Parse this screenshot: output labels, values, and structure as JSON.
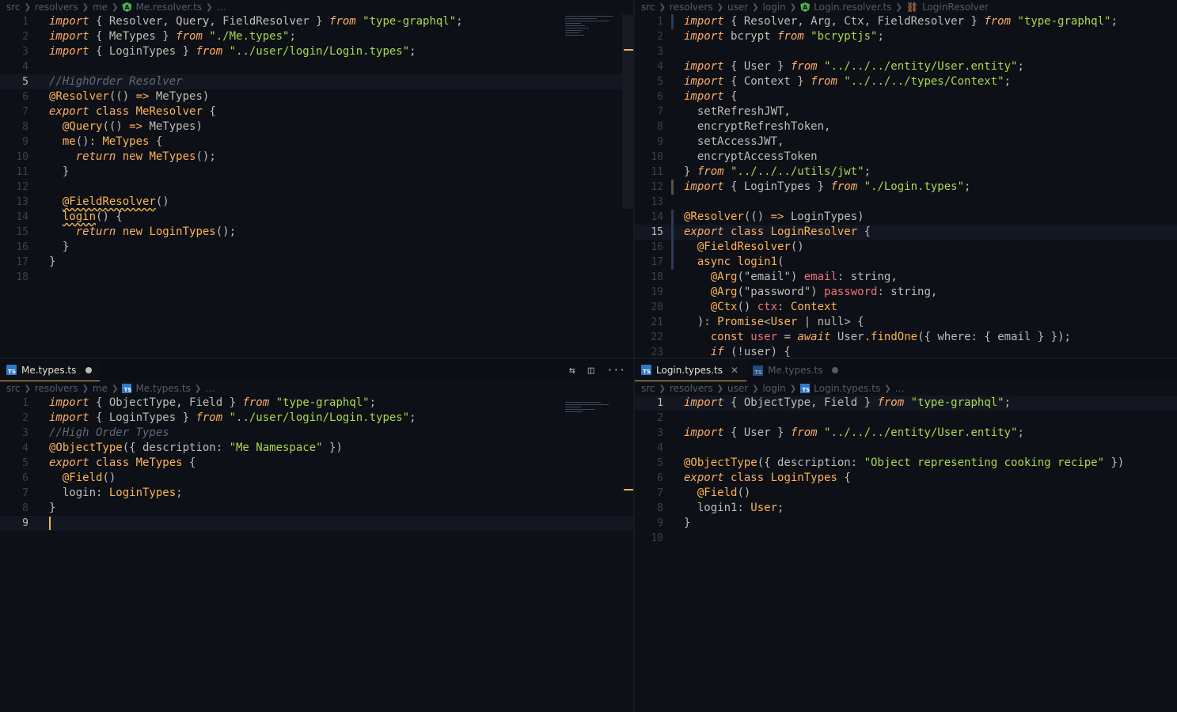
{
  "panes": {
    "top_left": {
      "breadcrumb": [
        "src",
        "resolvers",
        "me",
        "Me.resolver.ts",
        "…"
      ],
      "lines": [
        [
          [
            "c-imp",
            "import"
          ],
          [
            "c-plain",
            " { Resolver, Query, FieldResolver } "
          ],
          [
            "c-from",
            "from"
          ],
          [
            "c-str",
            " \"type-graphql\""
          ],
          [
            "c-plain",
            ";"
          ]
        ],
        [
          [
            "c-imp",
            "import"
          ],
          [
            "c-plain",
            " { MeTypes } "
          ],
          [
            "c-from",
            "from"
          ],
          [
            "c-str",
            " \"./Me.types\""
          ],
          [
            "c-plain",
            ";"
          ]
        ],
        [
          [
            "c-imp",
            "import"
          ],
          [
            "c-plain",
            " { LoginTypes } "
          ],
          [
            "c-from",
            "from"
          ],
          [
            "c-str",
            " \"../user/login/Login.types\""
          ],
          [
            "c-plain",
            ";"
          ]
        ],
        [],
        [
          [
            "c-cm",
            "//HighOrder Resolver"
          ]
        ],
        [
          [
            "c-dec",
            "@Resolver"
          ],
          [
            "c-plain",
            "(() "
          ],
          [
            "c-kw",
            "=>"
          ],
          [
            "c-plain",
            " MeTypes)"
          ]
        ],
        [
          [
            "c-imp",
            "export"
          ],
          [
            "c-kw",
            " class "
          ],
          [
            "c-fn",
            "MeResolver"
          ],
          [
            "c-plain",
            " {"
          ]
        ],
        [
          [
            "c-plain",
            "  "
          ],
          [
            "c-dec",
            "@Query"
          ],
          [
            "c-plain",
            "(() "
          ],
          [
            "c-kw",
            "=>"
          ],
          [
            "c-plain",
            " MeTypes)"
          ]
        ],
        [
          [
            "c-plain",
            "  "
          ],
          [
            "c-fn",
            "me"
          ],
          [
            "c-plain",
            "(): "
          ],
          [
            "c-fn",
            "MeTypes"
          ],
          [
            "c-plain",
            " {"
          ]
        ],
        [
          [
            "c-plain",
            "    "
          ],
          [
            "c-ret",
            "return"
          ],
          [
            "c-kw",
            " new "
          ],
          [
            "c-fn",
            "MeTypes"
          ],
          [
            "c-plain",
            "();"
          ]
        ],
        [
          [
            "c-plain",
            "  }"
          ]
        ],
        [],
        [
          [
            "c-plain",
            "  "
          ],
          [
            "c-dec",
            "@FieldResolver"
          ],
          [
            "c-plain",
            "()"
          ]
        ],
        [
          [
            "c-plain",
            "  "
          ],
          [
            "c-fn",
            "login"
          ],
          [
            "c-plain",
            "() {"
          ]
        ],
        [
          [
            "c-plain",
            "    "
          ],
          [
            "c-ret",
            "return"
          ],
          [
            "c-kw",
            " new "
          ],
          [
            "c-fn",
            "LoginTypes"
          ],
          [
            "c-plain",
            "();"
          ]
        ],
        [
          [
            "c-plain",
            "  }"
          ]
        ],
        [
          [
            "c-plain",
            "}"
          ]
        ],
        []
      ],
      "current_line": 5
    },
    "top_right": {
      "breadcrumb": [
        "src",
        "resolvers",
        "user",
        "login",
        "Login.resolver.ts",
        "LoginResolver"
      ],
      "lines": [
        [
          [
            "c-imp",
            "import"
          ],
          [
            "c-plain",
            " { Resolver, Arg, Ctx, FieldResolver } "
          ],
          [
            "c-from",
            "from"
          ],
          [
            "c-str",
            " \"type-graphql\""
          ],
          [
            "c-plain",
            ";"
          ]
        ],
        [
          [
            "c-imp",
            "import"
          ],
          [
            "c-plain",
            " bcrypt "
          ],
          [
            "c-from",
            "from"
          ],
          [
            "c-str",
            " \"bcryptjs\""
          ],
          [
            "c-plain",
            ";"
          ]
        ],
        [],
        [
          [
            "c-imp",
            "import"
          ],
          [
            "c-plain",
            " { User } "
          ],
          [
            "c-from",
            "from"
          ],
          [
            "c-str",
            " \"../../../entity/User.entity\""
          ],
          [
            "c-plain",
            ";"
          ]
        ],
        [
          [
            "c-imp",
            "import"
          ],
          [
            "c-plain",
            " { Context } "
          ],
          [
            "c-from",
            "from"
          ],
          [
            "c-str",
            " \"../../../types/Context\""
          ],
          [
            "c-plain",
            ";"
          ]
        ],
        [
          [
            "c-imp",
            "import"
          ],
          [
            "c-plain",
            " {"
          ]
        ],
        [
          [
            "c-plain",
            "  setRefreshJWT,"
          ]
        ],
        [
          [
            "c-plain",
            "  encryptRefreshToken,"
          ]
        ],
        [
          [
            "c-plain",
            "  setAccessJWT,"
          ]
        ],
        [
          [
            "c-plain",
            "  encryptAccessToken"
          ]
        ],
        [
          [
            "c-plain",
            "} "
          ],
          [
            "c-from",
            "from"
          ],
          [
            "c-str",
            " \"../../../utils/jwt\""
          ],
          [
            "c-plain",
            ";"
          ]
        ],
        [
          [
            "c-imp",
            "import"
          ],
          [
            "c-plain",
            " { LoginTypes } "
          ],
          [
            "c-from",
            "from"
          ],
          [
            "c-str",
            " \"./Login.types\""
          ],
          [
            "c-plain",
            ";"
          ]
        ],
        [],
        [
          [
            "c-dec",
            "@Resolver"
          ],
          [
            "c-plain",
            "(() "
          ],
          [
            "c-kw",
            "=>"
          ],
          [
            "c-plain",
            " LoginTypes)"
          ]
        ],
        [
          [
            "c-imp",
            "export"
          ],
          [
            "c-kw",
            " class "
          ],
          [
            "c-fn",
            "LoginResolver"
          ],
          [
            "c-plain",
            " {"
          ]
        ],
        [
          [
            "c-plain",
            "  "
          ],
          [
            "c-dec",
            "@FieldResolver"
          ],
          [
            "c-plain",
            "()"
          ]
        ],
        [
          [
            "c-plain",
            "  "
          ],
          [
            "c-kw",
            "async "
          ],
          [
            "c-fn",
            "login1"
          ],
          [
            "c-plain",
            "("
          ]
        ],
        [
          [
            "c-plain",
            "    "
          ],
          [
            "c-dec",
            "@Arg"
          ],
          [
            "c-plain",
            "(\"email\") "
          ],
          [
            "c-prm",
            "email"
          ],
          [
            "c-plain",
            ": string,"
          ]
        ],
        [
          [
            "c-plain",
            "    "
          ],
          [
            "c-dec",
            "@Arg"
          ],
          [
            "c-plain",
            "(\"password\") "
          ],
          [
            "c-prm",
            "password"
          ],
          [
            "c-plain",
            ": string,"
          ]
        ],
        [
          [
            "c-plain",
            "    "
          ],
          [
            "c-dec",
            "@Ctx"
          ],
          [
            "c-plain",
            "() "
          ],
          [
            "c-prm",
            "ctx"
          ],
          [
            "c-plain",
            ": "
          ],
          [
            "c-fn",
            "Context"
          ]
        ],
        [
          [
            "c-plain",
            "  ): "
          ],
          [
            "c-fn",
            "Promise"
          ],
          [
            "c-plain",
            "<"
          ],
          [
            "c-fn",
            "User"
          ],
          [
            "c-plain",
            " | null> {"
          ]
        ],
        [
          [
            "c-plain",
            "    "
          ],
          [
            "c-kw",
            "const "
          ],
          [
            "c-prm",
            "user"
          ],
          [
            "c-plain",
            " = "
          ],
          [
            "c-ret",
            "await"
          ],
          [
            "c-plain",
            " User."
          ],
          [
            "c-fn",
            "findOne"
          ],
          [
            "c-plain",
            "({ where: { email } });"
          ]
        ],
        [
          [
            "c-plain",
            "    "
          ],
          [
            "c-ret",
            "if"
          ],
          [
            "c-plain",
            " (!user) {"
          ]
        ]
      ],
      "current_line": 15
    },
    "bottom_left": {
      "tab": "Me.types.ts",
      "breadcrumb": [
        "src",
        "resolvers",
        "me",
        "Me.types.ts",
        "…"
      ],
      "lines": [
        [
          [
            "c-imp",
            "import"
          ],
          [
            "c-plain",
            " { ObjectType, Field } "
          ],
          [
            "c-from",
            "from"
          ],
          [
            "c-str",
            " \"type-graphql\""
          ],
          [
            "c-plain",
            ";"
          ]
        ],
        [
          [
            "c-imp",
            "import"
          ],
          [
            "c-plain",
            " { LoginTypes } "
          ],
          [
            "c-from",
            "from"
          ],
          [
            "c-str",
            " \"../user/login/Login.types\""
          ],
          [
            "c-plain",
            ";"
          ]
        ],
        [
          [
            "c-cm",
            "//High Order Types"
          ]
        ],
        [
          [
            "c-dec",
            "@ObjectType"
          ],
          [
            "c-plain",
            "({ description: "
          ],
          [
            "c-str",
            "\"Me Namespace\""
          ],
          [
            "c-plain",
            " })"
          ]
        ],
        [
          [
            "c-imp",
            "export"
          ],
          [
            "c-kw",
            " class "
          ],
          [
            "c-fn",
            "MeTypes"
          ],
          [
            "c-plain",
            " {"
          ]
        ],
        [
          [
            "c-plain",
            "  "
          ],
          [
            "c-dec",
            "@Field"
          ],
          [
            "c-plain",
            "()"
          ]
        ],
        [
          [
            "c-plain",
            "  login: "
          ],
          [
            "c-fn",
            "LoginTypes"
          ],
          [
            "c-plain",
            ";"
          ]
        ],
        [
          [
            "c-plain",
            "}"
          ]
        ],
        []
      ],
      "current_line": 9
    },
    "bottom_right": {
      "tabs": [
        {
          "label": "Login.types.ts",
          "active": true
        },
        {
          "label": "Me.types.ts",
          "active": false
        }
      ],
      "breadcrumb": [
        "src",
        "resolvers",
        "user",
        "login",
        "Login.types.ts",
        "…"
      ],
      "lines": [
        [
          [
            "c-imp",
            "import"
          ],
          [
            "c-plain",
            " { ObjectType, Field } "
          ],
          [
            "c-from",
            "from"
          ],
          [
            "c-str",
            " \"type-graphql\""
          ],
          [
            "c-plain",
            ";"
          ]
        ],
        [],
        [
          [
            "c-imp",
            "import"
          ],
          [
            "c-plain",
            " { User } "
          ],
          [
            "c-from",
            "from"
          ],
          [
            "c-str",
            " \"../../../entity/User.entity\""
          ],
          [
            "c-plain",
            ";"
          ]
        ],
        [],
        [
          [
            "c-dec",
            "@ObjectType"
          ],
          [
            "c-plain",
            "({ description: "
          ],
          [
            "c-str",
            "\"Object representing cooking recipe\""
          ],
          [
            "c-plain",
            " })"
          ]
        ],
        [
          [
            "c-imp",
            "export"
          ],
          [
            "c-kw",
            " class "
          ],
          [
            "c-fn",
            "LoginTypes"
          ],
          [
            "c-plain",
            " {"
          ]
        ],
        [
          [
            "c-plain",
            "  "
          ],
          [
            "c-dec",
            "@Field"
          ],
          [
            "c-plain",
            "()"
          ]
        ],
        [
          [
            "c-plain",
            "  login1: "
          ],
          [
            "c-fn",
            "User"
          ],
          [
            "c-plain",
            ";"
          ]
        ],
        [
          [
            "c-plain",
            "}"
          ]
        ],
        []
      ],
      "current_line": 1
    }
  },
  "tab_actions": [
    "compare-changes-icon",
    "split-editor-icon",
    "more-actions-icon"
  ],
  "colors": {
    "accent": "#e6b450",
    "background": "#0d1017",
    "ts_icon": "#3178c6"
  }
}
